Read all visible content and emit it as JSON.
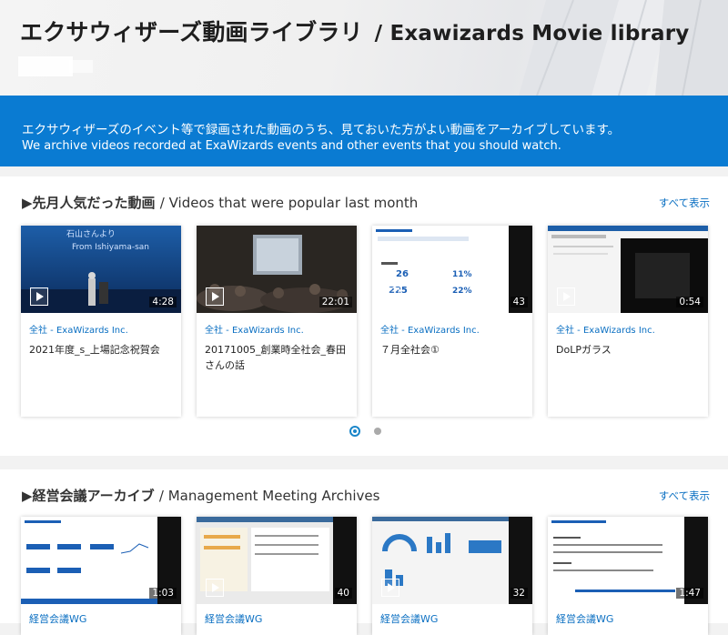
{
  "header": {
    "title_jp": "エクサウィザーズ動画ライブラリ",
    "title_sep_en": "/ Exawizards Movie library"
  },
  "banner": {
    "line_jp": "エクサウィザーズのイベント等で録画された動画のうち、見ておいた方がよい動画をアーカイブしています。",
    "line_en": "We archive videos recorded at ExaWizards events and other events that you should watch."
  },
  "sections": [
    {
      "title_jp": "▶先月人気だった動画",
      "title_en": "/ Videos that were popular last month",
      "show_all": "すべて表示",
      "cards": [
        {
          "category": "全社 - ExaWizards Inc.",
          "title": "2021年度_s_上場記念祝賀会",
          "duration": "4:28",
          "thumb_text": [
            "石山さんより",
            "From Ishiyama-san"
          ]
        },
        {
          "category": "全社 - ExaWizards Inc.",
          "title": "20171005_創業時全社会_春田さんの話",
          "duration": "22:01"
        },
        {
          "category": "全社 - ExaWizards Inc.",
          "title": "７月全社会①",
          "duration": "43"
        },
        {
          "category": "全社 - ExaWizards Inc.",
          "title": "DoLPガラス",
          "duration": "0:54"
        }
      ]
    },
    {
      "title_jp": "▶経営会議アーカイブ",
      "title_en": "/ Management Meeting Archives",
      "show_all": "すべて表示",
      "cards": [
        {
          "category": "経営会議WG",
          "duration": "1:03"
        },
        {
          "category": "経営会議WG",
          "duration": "40"
        },
        {
          "category": "経営会議WG",
          "duration": "32"
        },
        {
          "category": "経営会議WG",
          "duration": "1:47"
        }
      ]
    }
  ],
  "carousel": {
    "pages": 2,
    "active": 1
  },
  "colors": {
    "accent": "#0a7bd2",
    "link": "#0a6fc2",
    "banner_text": "#ffffff"
  }
}
